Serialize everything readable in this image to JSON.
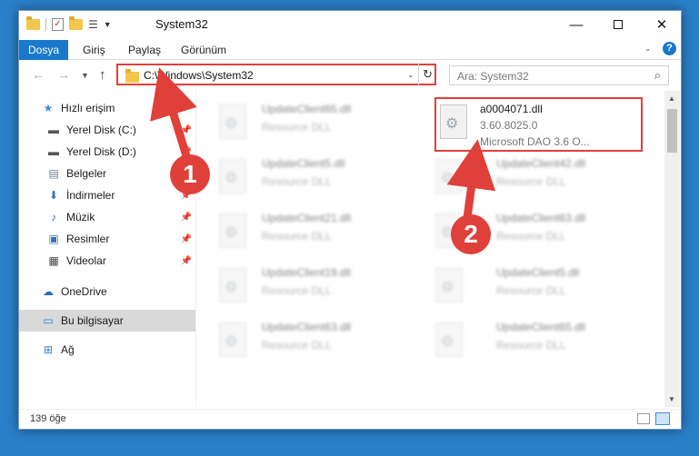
{
  "window": {
    "title": "System32"
  },
  "ribbon": {
    "tabs": [
      "Dosya",
      "Giriş",
      "Paylaş",
      "Görünüm"
    ],
    "help": "?"
  },
  "nav": {
    "address": "C:\\Windows\\System32",
    "search_placeholder": "Ara: System32"
  },
  "sidebar": {
    "items": [
      {
        "label": "Hızlı erişim",
        "icon": "star-icon"
      },
      {
        "label": "Yerel Disk (C:)",
        "icon": "drive-icon"
      },
      {
        "label": "Yerel Disk (D:)",
        "icon": "drive-icon"
      },
      {
        "label": "Belgeler",
        "icon": "documents-icon"
      },
      {
        "label": "İndirmeler",
        "icon": "download-icon"
      },
      {
        "label": "Müzik",
        "icon": "music-icon"
      },
      {
        "label": "Resimler",
        "icon": "pictures-icon"
      },
      {
        "label": "Videolar",
        "icon": "video-icon"
      },
      {
        "label": "OneDrive",
        "icon": "cloud-icon"
      },
      {
        "label": "Bu bilgisayar",
        "icon": "computer-icon"
      },
      {
        "label": "Ağ",
        "icon": "network-icon"
      }
    ]
  },
  "files": {
    "highlighted": {
      "name": "a0004071.dll",
      "version": "3.60.8025.0",
      "desc": "Microsoft DAO 3.6 O..."
    },
    "left": [
      {
        "name": "UpdateClient65.dll",
        "type": "Resource DLL"
      },
      {
        "name": "UpdateClient5.dll",
        "type": "Resource DLL"
      },
      {
        "name": "UpdateClient21.dll",
        "type": "Resource DLL"
      },
      {
        "name": "UpdateClient19.dll",
        "type": "Resource DLL"
      },
      {
        "name": "UpdateClient63.dll",
        "type": "Resource DLL"
      }
    ],
    "right": [
      {
        "name": "UpdateClient42.dll",
        "type": "Resource DLL"
      },
      {
        "name": "UpdateClient63.dll",
        "type": "Resource DLL"
      },
      {
        "name": "UpdateClient5.dll",
        "type": "Resource DLL"
      },
      {
        "name": "UpdateClient65.dll",
        "type": "Resource DLL"
      }
    ]
  },
  "status": {
    "count": "139 öğe"
  },
  "annotations": {
    "badge1": "1",
    "badge2": "2",
    "color": "#e0403a"
  }
}
